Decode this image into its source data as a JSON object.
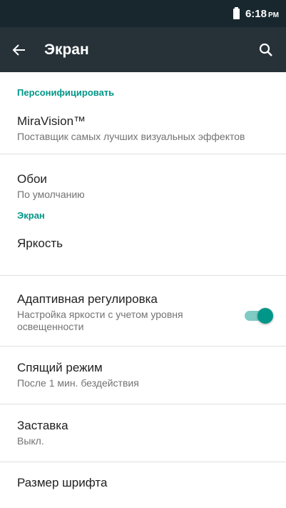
{
  "status_bar": {
    "time": "6:18",
    "ampm": "PM"
  },
  "app_bar": {
    "title": "Экран"
  },
  "sections": {
    "personalize": {
      "header": "Персонифицировать",
      "items": [
        {
          "title": "MiraVision™",
          "summary": "Поставщик самых лучших визуальных эффектов"
        },
        {
          "title": "Обои",
          "summary": "По умолчанию"
        }
      ]
    },
    "screen": {
      "header": "Экран",
      "items": [
        {
          "title": "Яркость"
        },
        {
          "title": "Адаптивная регулировка",
          "summary": "Настройка яркости с учетом уровня освещенности",
          "toggle_on": true
        },
        {
          "title": "Спящий режим",
          "summary": "После 1 мин. бездействия"
        },
        {
          "title": "Заставка",
          "summary": "Выкл."
        },
        {
          "title": "Размер шрифта"
        }
      ]
    }
  },
  "colors": {
    "accent": "#009688",
    "app_bar": "#263238",
    "status_bar": "#18272d"
  }
}
